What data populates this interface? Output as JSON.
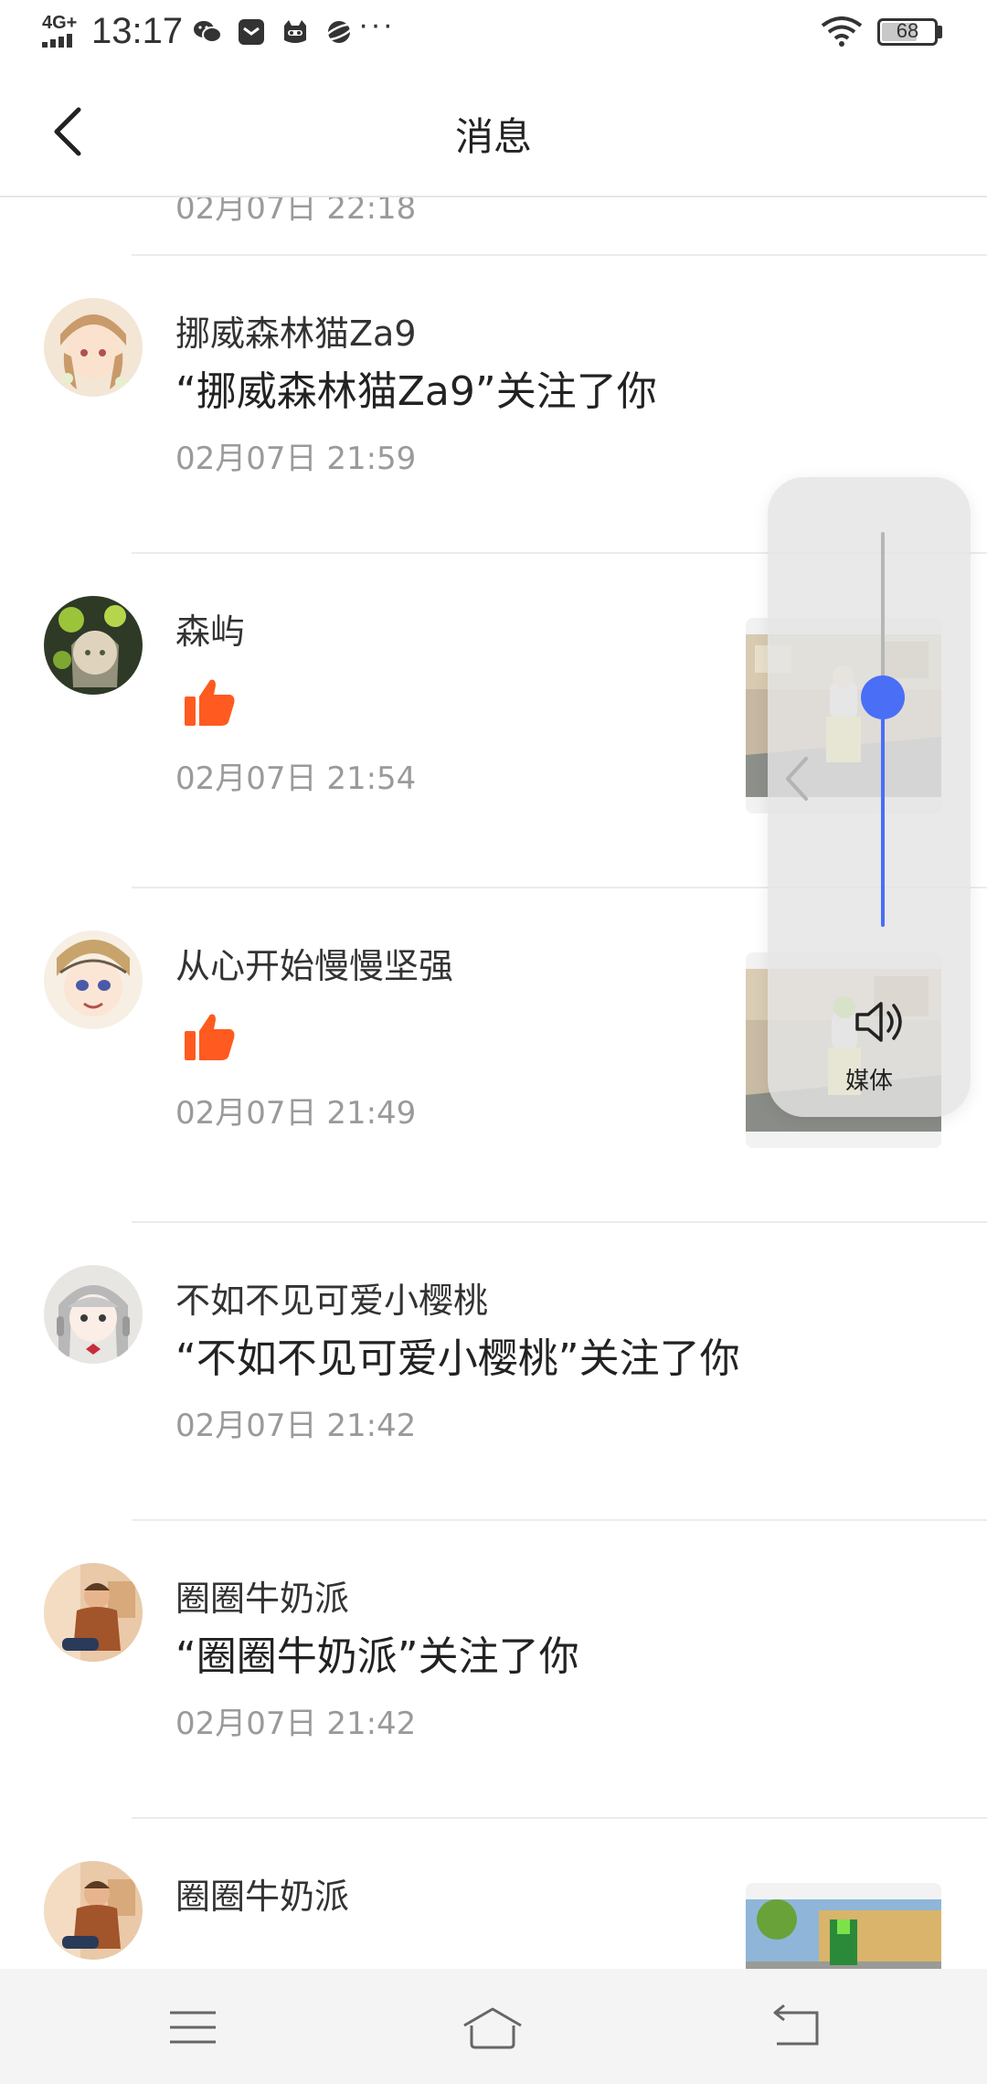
{
  "status_bar": {
    "network": "4G+",
    "time": "13:17",
    "more": "···",
    "battery": "68",
    "battery_level_percent": 68
  },
  "header": {
    "title": "消息"
  },
  "partial_time": "02月07日 22:18",
  "messages": [
    {
      "name": "挪威森林猫Za9",
      "content": "“挪威森林猫Za9”关注了你",
      "time": "02月07日 21:59",
      "type": "follow"
    },
    {
      "name": "森屿",
      "content": "",
      "time": "02月07日 21:54",
      "type": "like"
    },
    {
      "name": "从心开始慢慢坚强",
      "content": "",
      "time": "02月07日 21:49",
      "type": "like"
    },
    {
      "name": "不如不见可爱小樱桃",
      "content": "“不如不见可爱小樱桃”关注了你",
      "time": "02月07日 21:42",
      "type": "follow"
    },
    {
      "name": "圈圈牛奶派",
      "content": "“圈圈牛奶派”关注了你",
      "time": "02月07日 21:42",
      "type": "follow"
    },
    {
      "name": "圈圈牛奶派",
      "content": "",
      "time": "",
      "type": "like"
    }
  ],
  "volume": {
    "label": "媒体",
    "level_fraction": 0.58
  },
  "navbar": {
    "icons": [
      "menu-icon",
      "home-icon",
      "back-icon"
    ]
  },
  "colors": {
    "accent": "#4a6ef5",
    "like": "#ff5a1f",
    "secondary_text": "#9a9a9a",
    "divider": "#ececec"
  }
}
